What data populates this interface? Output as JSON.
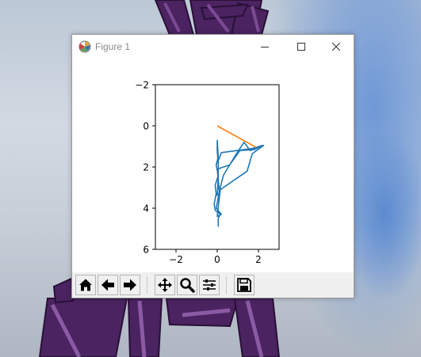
{
  "window": {
    "title": "Figure 1"
  },
  "icons": {
    "app": "matplotlib-figure-icon",
    "minimize": "minimize-icon",
    "maximize": "maximize-icon",
    "close": "close-icon"
  },
  "toolbar": {
    "buttons": [
      {
        "name": "home-button",
        "icon": "home-icon"
      },
      {
        "name": "back-button",
        "icon": "arrow-left-icon"
      },
      {
        "name": "forward-button",
        "icon": "arrow-right-icon"
      },
      {
        "name": "pan-button",
        "icon": "move-icon"
      },
      {
        "name": "zoom-button",
        "icon": "magnifier-icon"
      },
      {
        "name": "configure-subplots-button",
        "icon": "sliders-icon"
      },
      {
        "name": "save-button",
        "icon": "floppy-disk-icon"
      }
    ]
  },
  "chart_data": {
    "type": "line",
    "xlim": [
      -3,
      3
    ],
    "ylim": [
      6,
      -2
    ],
    "y_inverted": true,
    "xticks": [
      -2,
      0,
      2
    ],
    "yticks": [
      -2,
      0,
      2,
      4,
      6
    ],
    "xtick_labels": [
      "−2",
      "0",
      "2"
    ],
    "ytick_labels": [
      "−2",
      "0",
      "2",
      "4",
      "6"
    ],
    "grid": false,
    "legend": "none",
    "series": [
      {
        "color": "#1f77b4",
        "points": [
          [
            0.05,
            4.9
          ],
          [
            0.05,
            4.5
          ],
          [
            0.15,
            4.3
          ],
          [
            -0.1,
            4.1
          ],
          [
            -0.15,
            3.8
          ],
          [
            -0.05,
            3.3
          ],
          [
            -0.1,
            2.9
          ],
          [
            0.05,
            2.4
          ],
          [
            -0.05,
            1.9
          ],
          [
            0.05,
            1.5
          ],
          [
            0.0,
            0.7
          ],
          [
            0.0,
            1.2
          ],
          [
            0.05,
            1.9
          ],
          [
            0.05,
            2.6
          ],
          [
            0.1,
            3.2
          ],
          [
            0.3,
            2.4
          ],
          [
            0.9,
            1.4
          ],
          [
            1.3,
            0.8
          ],
          [
            1.6,
            1.2
          ],
          [
            2.25,
            0.95
          ],
          [
            1.7,
            1.35
          ],
          [
            1.45,
            2.2
          ],
          [
            0.15,
            3.1
          ],
          [
            0.1,
            3.5
          ],
          [
            0.0,
            4.4
          ],
          [
            0.2,
            4.3
          ],
          [
            -0.05,
            4.0
          ],
          [
            0.1,
            3.2
          ],
          [
            0.0,
            2.1
          ],
          [
            0.6,
            1.9
          ],
          [
            1.1,
            1.2
          ],
          [
            1.8,
            1.15
          ],
          [
            2.2,
            0.95
          ],
          [
            1.7,
            1.1
          ],
          [
            0.2,
            1.3
          ],
          [
            0.05,
            1.7
          ],
          [
            0.05,
            2.5
          ],
          [
            0.0,
            3.4
          ]
        ]
      },
      {
        "color": "#ff7f0e",
        "points": [
          [
            0.0,
            0.0
          ],
          [
            1.9,
            1.05
          ]
        ]
      }
    ]
  }
}
